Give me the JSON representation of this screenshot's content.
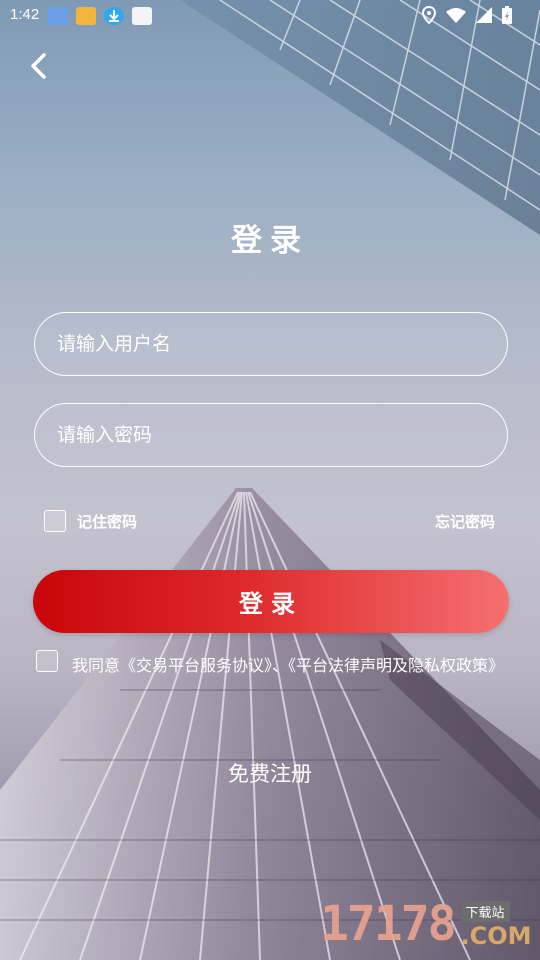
{
  "status_bar": {
    "time": "1:42",
    "notifications": [
      "app-notification-icon",
      "app-notification-icon",
      "download-notification-icon",
      "app-notification-icon"
    ],
    "icons": [
      "location-icon",
      "wifi-icon",
      "signal-icon",
      "battery-charging-icon"
    ]
  },
  "page": {
    "title": "登录"
  },
  "form": {
    "username_placeholder": "请输入用户名",
    "password_placeholder": "请输入密码",
    "remember_label": "记住密码",
    "forgot_label": "忘记密码",
    "login_button": "登录",
    "agreement_text": "我同意《交易平台服务协议》、《平台法律声明及隐私权政策》",
    "register_link": "免费注册"
  },
  "watermark": {
    "number": "17178",
    "tag": "下载站",
    "suffix": ".COM"
  },
  "colors": {
    "button_start": "#c8050a",
    "button_end": "#f57070"
  }
}
